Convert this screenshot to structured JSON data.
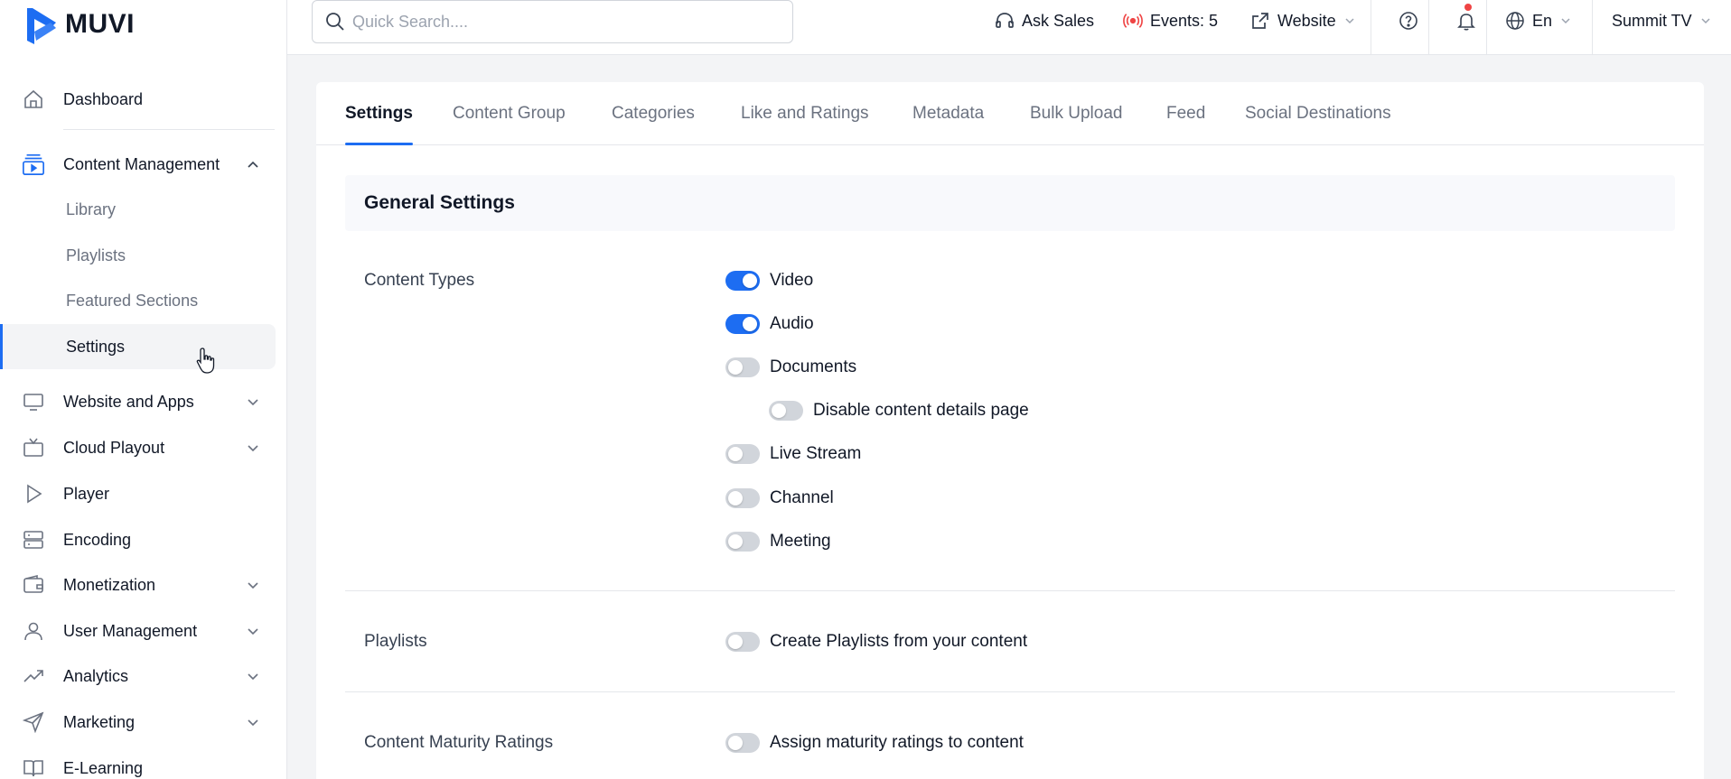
{
  "brand": {
    "name": "MUVI",
    "accent": "#1d6df2"
  },
  "sidebar": {
    "items": [
      {
        "label": "Dashboard",
        "icon": "home-icon"
      },
      {
        "label": "Content Management",
        "icon": "content-management-icon",
        "expanded": true,
        "children": [
          {
            "label": "Library"
          },
          {
            "label": "Playlists"
          },
          {
            "label": "Featured Sections"
          },
          {
            "label": "Settings",
            "active": true
          }
        ]
      },
      {
        "label": "Website and Apps",
        "icon": "monitor-icon"
      },
      {
        "label": "Cloud Playout",
        "icon": "tv-icon"
      },
      {
        "label": "Player",
        "icon": "play-icon"
      },
      {
        "label": "Encoding",
        "icon": "server-icon"
      },
      {
        "label": "Monetization",
        "icon": "wallet-icon"
      },
      {
        "label": "User Management",
        "icon": "user-icon"
      },
      {
        "label": "Analytics",
        "icon": "trend-icon"
      },
      {
        "label": "Marketing",
        "icon": "send-icon"
      },
      {
        "label": "E-Learning",
        "icon": "book-icon"
      }
    ]
  },
  "topbar": {
    "search_placeholder": "Quick Search....",
    "ask_sales": "Ask Sales",
    "events": "Events: 5",
    "website": "Website",
    "language": "En",
    "account": "Summit TV"
  },
  "tabs": [
    {
      "label": "Settings",
      "active": true
    },
    {
      "label": "Content Group"
    },
    {
      "label": "Categories"
    },
    {
      "label": "Like and Ratings"
    },
    {
      "label": "Metadata"
    },
    {
      "label": "Bulk Upload"
    },
    {
      "label": "Feed"
    },
    {
      "label": "Social Destinations"
    }
  ],
  "general_settings": {
    "title": "General Settings",
    "content_types": {
      "label": "Content Types",
      "options": [
        {
          "label": "Video",
          "on": true
        },
        {
          "label": "Audio",
          "on": true
        },
        {
          "label": "Documents",
          "on": false
        },
        {
          "label": "Disable content details page",
          "on": false
        },
        {
          "label": "Live Stream",
          "on": false
        },
        {
          "label": "Channel",
          "on": false
        },
        {
          "label": "Meeting",
          "on": false
        }
      ]
    },
    "playlists": {
      "label": "Playlists",
      "option": "Create Playlists from your content",
      "on": false
    },
    "maturity": {
      "label": "Content Maturity Ratings",
      "option": "Assign maturity ratings to content",
      "on": false
    }
  }
}
